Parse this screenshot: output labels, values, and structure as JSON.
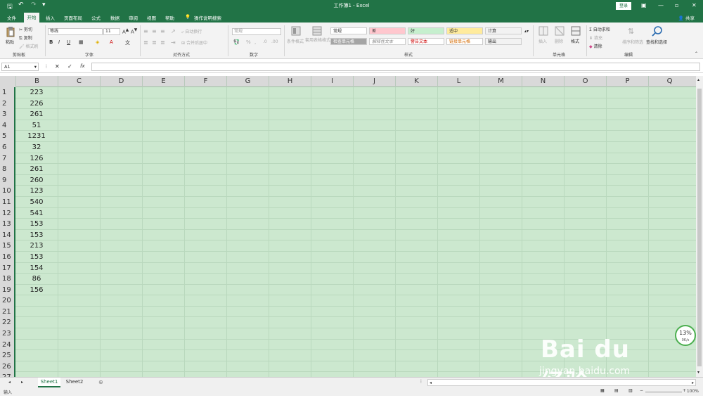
{
  "title_bar": {
    "title": "工作簿1 - Excel",
    "login": "登录",
    "minimize": "—",
    "restore": "▫",
    "close": "✕"
  },
  "tabs": [
    "文件",
    "开始",
    "插入",
    "页面布局",
    "公式",
    "数据",
    "审阅",
    "视图",
    "帮助"
  ],
  "tell_me": "操作说明搜索",
  "share": "共享",
  "ribbon": {
    "clipboard": {
      "label": "剪贴板",
      "paste": "粘贴",
      "cut": "剪切",
      "copy": "复制",
      "format_painter": "格式刷"
    },
    "font": {
      "label": "字体",
      "font_name": "等线",
      "font_size": "11"
    },
    "alignment": {
      "label": "对齐方式",
      "wrap": "自动换行",
      "merge": "合并后居中"
    },
    "number": {
      "label": "数字",
      "format": "常规"
    },
    "styles": {
      "label": "样式",
      "conditional": "条件格式",
      "table_format": "套用表格格式",
      "cells": [
        {
          "text": "常规",
          "color": "#ffffff"
        },
        {
          "text": "差",
          "color": "#ffc7ce"
        },
        {
          "text": "好",
          "color": "#c6efce"
        },
        {
          "text": "适中",
          "color": "#ffeb9c"
        },
        {
          "text": "计算",
          "color": "#f2f2f2"
        },
        {
          "text": "检查单元格",
          "color": "#a5a5a5"
        },
        {
          "text": "解释性文本",
          "color": "#ffffff"
        },
        {
          "text": "警告文本",
          "color": "#ffffff"
        },
        {
          "text": "链接单元格",
          "color": "#ffffff"
        },
        {
          "text": "输出",
          "color": "#f2f2f2"
        }
      ]
    },
    "cells": {
      "label": "单元格",
      "insert": "插入",
      "delete": "删除",
      "format": "格式"
    },
    "editing": {
      "label": "编辑",
      "autosum": "自动求和",
      "fill": "填充",
      "clear": "清除",
      "sort": "排序和筛选",
      "find": "查找和选择"
    }
  },
  "formula_bar": {
    "namebox": "A1",
    "fx": "fx",
    "cancel": "✕",
    "confirm": "✓"
  },
  "columns": [
    "B",
    "C",
    "D",
    "E",
    "F",
    "G",
    "H",
    "I",
    "J",
    "K",
    "L",
    "M",
    "N",
    "O",
    "P",
    "Q"
  ],
  "rows": [
    {
      "num": "1",
      "b": "223"
    },
    {
      "num": "2",
      "b": "226"
    },
    {
      "num": "3",
      "b": "261"
    },
    {
      "num": "4",
      "b": "51"
    },
    {
      "num": "5",
      "b": "1231"
    },
    {
      "num": "6",
      "b": "32"
    },
    {
      "num": "7",
      "b": "126"
    },
    {
      "num": "8",
      "b": "261"
    },
    {
      "num": "9",
      "b": "260"
    },
    {
      "num": "10",
      "b": "123"
    },
    {
      "num": "11",
      "b": "540"
    },
    {
      "num": "12",
      "b": "541"
    },
    {
      "num": "13",
      "b": "153"
    },
    {
      "num": "14",
      "b": "153"
    },
    {
      "num": "15",
      "b": "213"
    },
    {
      "num": "16",
      "b": "153"
    },
    {
      "num": "17",
      "b": "154"
    },
    {
      "num": "18",
      "b": "86"
    },
    {
      "num": "19",
      "b": "156"
    },
    {
      "num": "20",
      "b": ""
    },
    {
      "num": "21",
      "b": ""
    },
    {
      "num": "22",
      "b": ""
    },
    {
      "num": "23",
      "b": ""
    },
    {
      "num": "24",
      "b": ""
    },
    {
      "num": "25",
      "b": ""
    },
    {
      "num": "26",
      "b": ""
    },
    {
      "num": "27",
      "b": ""
    }
  ],
  "sheets": [
    "Sheet1",
    "Sheet2"
  ],
  "status": {
    "mode": "输入",
    "zoom": "100%"
  },
  "speed_widget": {
    "percent": "13%",
    "rate": "0K/s"
  },
  "watermark": {
    "text": "Bai du 经验",
    "url": "jingyan.baidu.com"
  },
  "colors": {
    "accent": "#217346",
    "grid_bg": "#cce8cf"
  }
}
